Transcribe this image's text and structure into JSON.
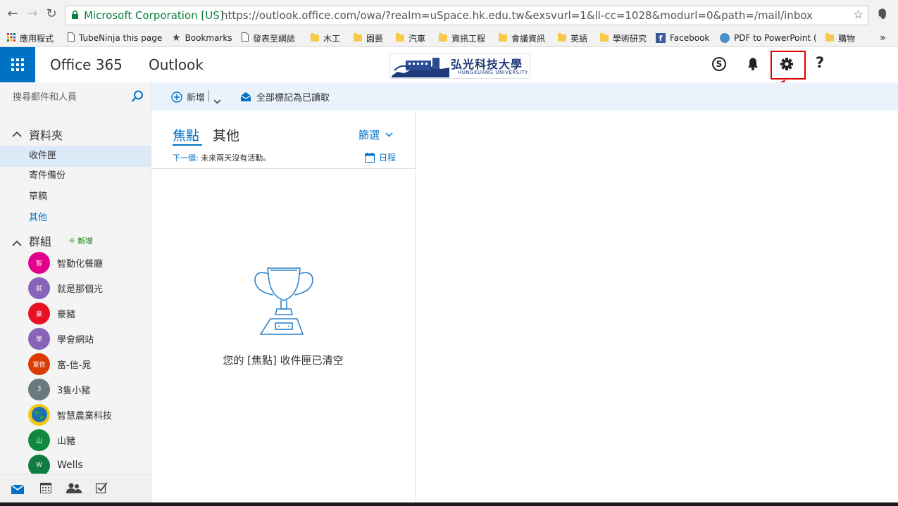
{
  "browser": {
    "site_identity": "Microsoft Corporation [US]",
    "url": "https://outlook.office.com/owa/?realm=uSpace.hk.edu.tw&exsvurl=1&ll-cc=1028&modurl=0&path=/mail/inbox",
    "bookmarks": [
      "應用程式",
      "TubeNinja this page",
      "Bookmarks",
      "發表至網誌",
      "木工",
      "園藝",
      "汽車",
      "資訊工程",
      "會議資訊",
      "英語",
      "學術研究",
      "Facebook",
      "PDF to PowerPoint (",
      "購物"
    ],
    "more": "»"
  },
  "header": {
    "suite": "Office 365",
    "app": "Outlook",
    "logo_text": "弘光科技大學",
    "logo_sub": "HUNGKUANG UNIVERSITY",
    "skype": "S",
    "help": "?"
  },
  "search": {
    "placeholder": "搜尋郵件和人員"
  },
  "toolbar": {
    "new_label": "新增",
    "mark_all_read": "全部標記為已讀取"
  },
  "folders": {
    "heading": "資料夾",
    "items": [
      "收件匣",
      "寄件備份",
      "草稿",
      "其他"
    ]
  },
  "groups": {
    "heading": "群組",
    "new_label": "新增",
    "items": [
      {
        "initial": "智",
        "name": "智動化餐廳",
        "color": "#e3008c"
      },
      {
        "initial": "就",
        "name": "就是那個光",
        "color": "#8764b8"
      },
      {
        "initial": "豪",
        "name": "豪豬",
        "color": "#e81123"
      },
      {
        "initial": "學",
        "name": "學會網站",
        "color": "#8764b8"
      },
      {
        "initial": "富信",
        "name": "富-信-晁",
        "color": "#da3b01"
      },
      {
        "initial": "3",
        "name": "3隻小豬",
        "color": "#69797e"
      },
      {
        "initial": "",
        "name": "智慧農業科技",
        "color": "#107c10"
      },
      {
        "initial": "山",
        "name": "山豬",
        "color": "#10893e"
      },
      {
        "initial": "W",
        "name": "Wells",
        "color": "#107c41"
      }
    ]
  },
  "inbox": {
    "tab_focused": "焦點",
    "tab_other": "其他",
    "filter_label": "篩選",
    "next_label": "下一個:",
    "next_text": "未來兩天沒有活動。",
    "calendar_label": "日程",
    "empty_message": "您的 [焦點] 收件匣已清空"
  },
  "colors": {
    "accent": "#0072c6",
    "highlight": "#e00000"
  }
}
